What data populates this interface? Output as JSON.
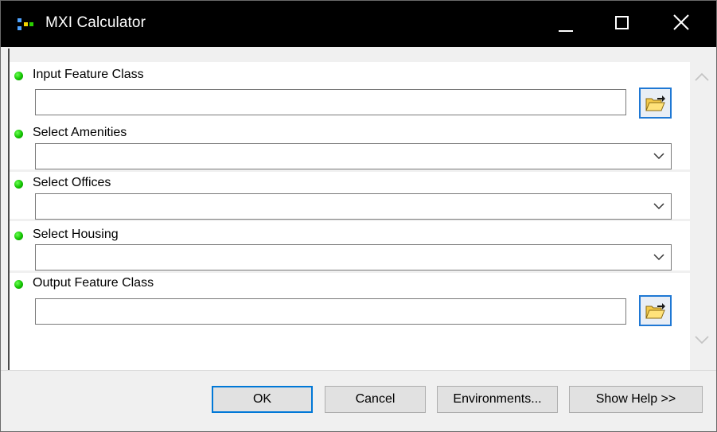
{
  "window": {
    "title": "MXI Calculator",
    "icon": "toolbox-model-icon"
  },
  "titlebar_buttons": {
    "minimize_icon": "minimize-icon",
    "maximize_icon": "maximize-icon",
    "close_icon": "close-icon"
  },
  "parameters": {
    "input_feature_class": {
      "label": "Input Feature Class",
      "value": "",
      "required": true
    },
    "select_amenities": {
      "label": "Select Amenities",
      "value": "",
      "required": true
    },
    "select_offices": {
      "label": "Select Offices",
      "value": "",
      "required": true
    },
    "select_housing": {
      "label": "Select Housing",
      "value": "",
      "required": true
    },
    "output_feature_class": {
      "label": "Output Feature Class",
      "value": "",
      "required": true
    }
  },
  "buttons": {
    "ok": "OK",
    "cancel": "Cancel",
    "environments": "Environments...",
    "show_help": "Show Help >>"
  },
  "colors": {
    "titlebar": "#000000",
    "required_dot": "#12c400",
    "focus_border": "#0078d7"
  }
}
